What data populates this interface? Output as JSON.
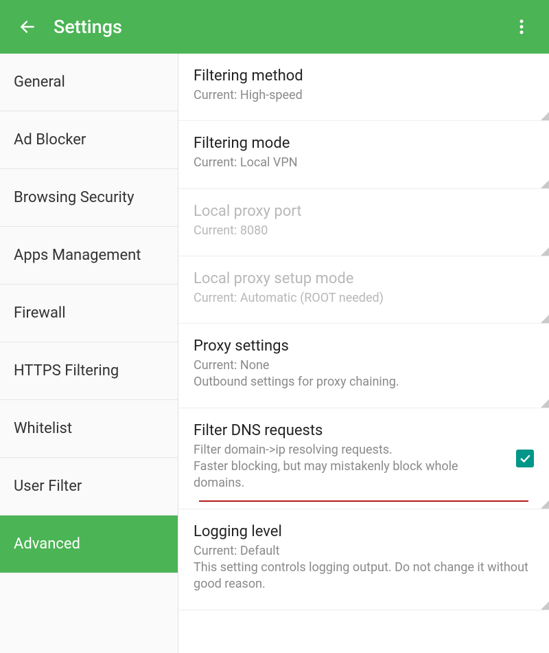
{
  "header": {
    "title": "Settings"
  },
  "sidebar": {
    "items": [
      {
        "label": "General"
      },
      {
        "label": "Ad Blocker"
      },
      {
        "label": "Browsing Security"
      },
      {
        "label": "Apps Management"
      },
      {
        "label": "Firewall"
      },
      {
        "label": "HTTPS Filtering"
      },
      {
        "label": "Whitelist"
      },
      {
        "label": "User Filter"
      },
      {
        "label": "Advanced"
      }
    ],
    "active_index": 8
  },
  "settings": [
    {
      "title": "Filtering method",
      "sub": "Current: High-speed",
      "disabled": false,
      "checkbox": null
    },
    {
      "title": "Filtering mode",
      "sub": "Current: Local VPN",
      "disabled": false,
      "checkbox": null
    },
    {
      "title": "Local proxy port",
      "sub": "Current: 8080",
      "disabled": true,
      "checkbox": null
    },
    {
      "title": "Local proxy setup mode",
      "sub": "Current: Automatic (ROOT needed)",
      "disabled": true,
      "checkbox": null
    },
    {
      "title": "Proxy settings",
      "sub": "Current: None\nOutbound settings for proxy chaining.",
      "disabled": false,
      "checkbox": null
    },
    {
      "title": "Filter DNS requests",
      "sub": "Filter domain->ip resolving requests.\nFaster blocking, but may mistakenly block whole domains.",
      "disabled": false,
      "checkbox": true,
      "underline": true
    },
    {
      "title": "Logging level",
      "sub": "Current: Default\nThis setting controls logging output. Do not change it without good reason.",
      "disabled": false,
      "checkbox": null
    }
  ]
}
